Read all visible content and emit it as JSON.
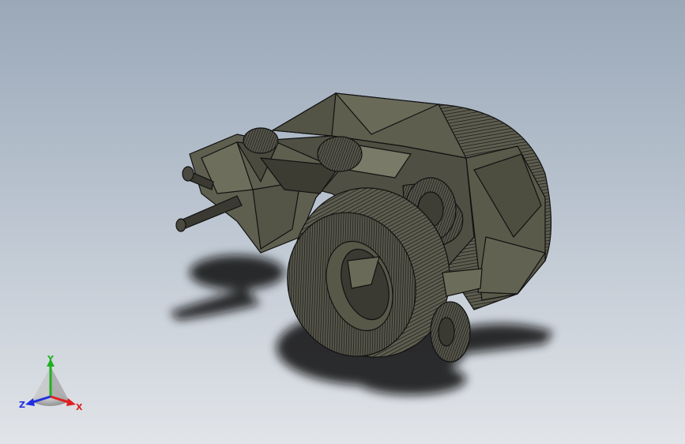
{
  "viewport": {
    "background_top": "#9aa8b8",
    "background_bottom": "#e1e4e8",
    "model_color": "#5b5b4c",
    "edge_color": "#111111"
  },
  "triad": {
    "x_label": "X",
    "y_label": "Y",
    "z_label": "Z",
    "x_color": "#e02020",
    "y_color": "#20b020",
    "z_color": "#2030e0"
  }
}
